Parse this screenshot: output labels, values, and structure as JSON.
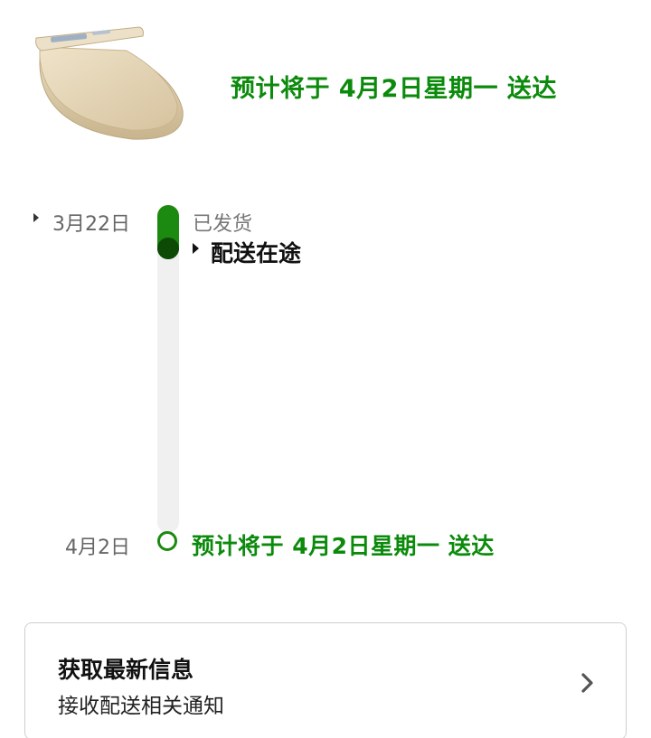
{
  "header": {
    "product_image": "toilet-seat-product-image",
    "delivery_estimate": "预计将于 4月2日星期一 送达"
  },
  "timeline": {
    "start_date": "3月22日",
    "shipped_label": "已发货",
    "current_status": "配送在途",
    "end_date": "4月2日",
    "end_label": "预计将于 4月2日星期一 送达",
    "progress_fraction": 0.03
  },
  "updates_card": {
    "title": "获取最新信息",
    "subtitle": "接收配送相关通知",
    "chevron_icon": "chevron-right-icon"
  },
  "colors": {
    "accent_green": "#0b8a0b",
    "track_fill": "#1c8a10",
    "track_dot": "#0c4a06",
    "track_bg": "#f0f0f0"
  }
}
